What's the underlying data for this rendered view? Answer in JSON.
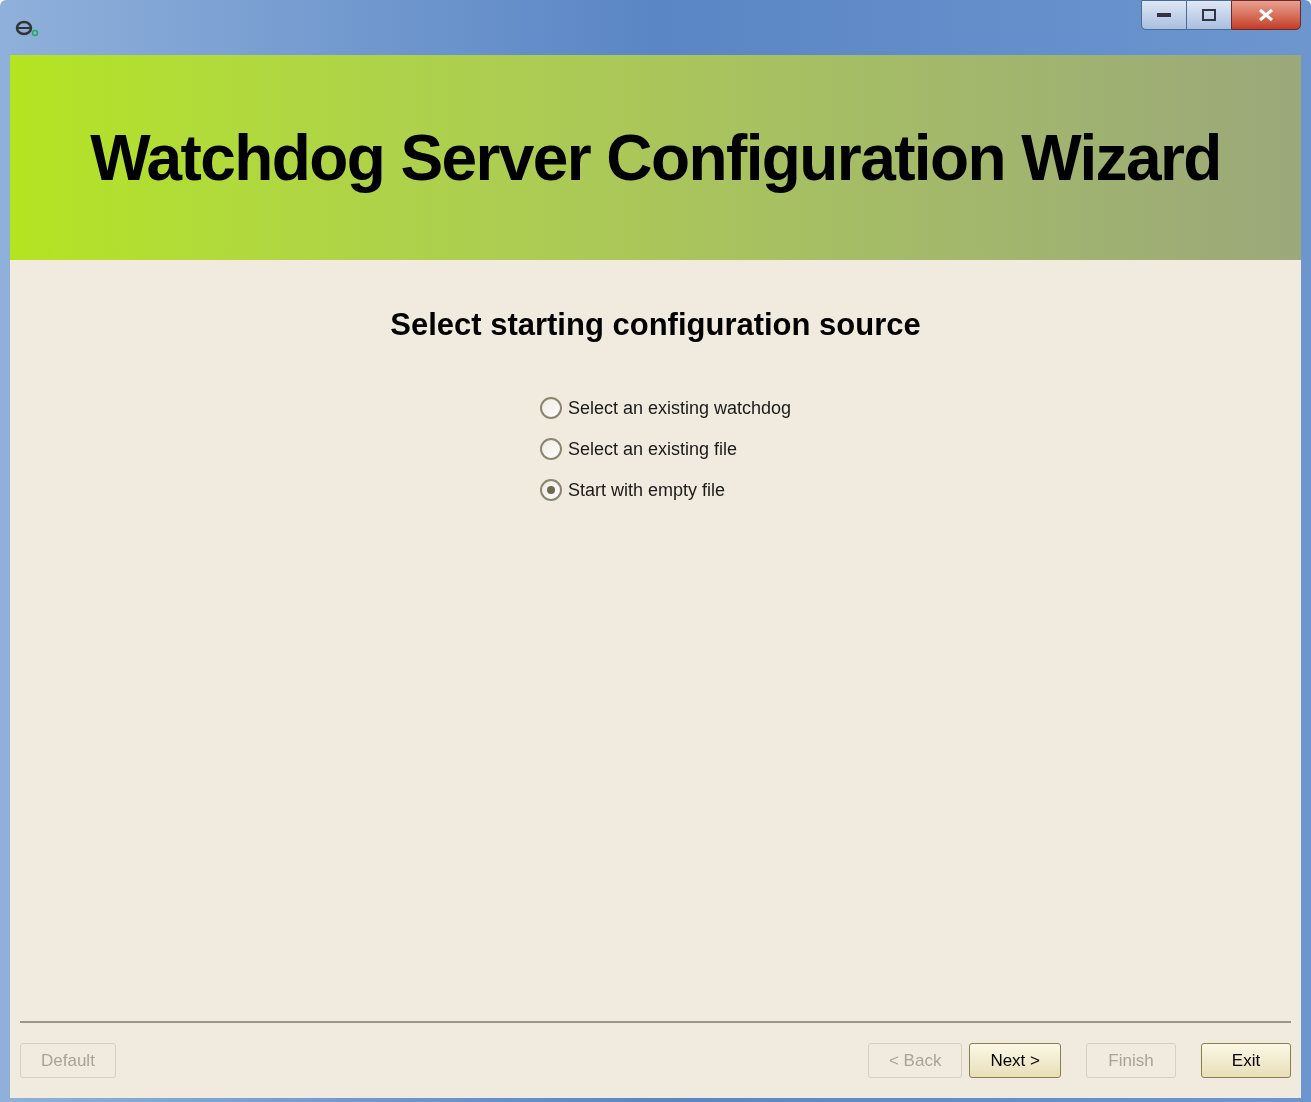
{
  "banner": {
    "title": "Watchdog Server Configuration Wizard"
  },
  "heading": "Select starting configuration source",
  "options": [
    {
      "label": "Select an existing watchdog",
      "selected": false
    },
    {
      "label": "Select an existing file",
      "selected": false
    },
    {
      "label": "Start with empty file",
      "selected": true
    }
  ],
  "left_buttons": [
    {
      "label": "Default",
      "disabled": true
    }
  ],
  "right_buttons": [
    {
      "label": "< Back",
      "disabled": true
    },
    {
      "label": "Next >",
      "disabled": false
    },
    {
      "label": "Finish",
      "disabled": true
    },
    {
      "label": "Exit",
      "disabled": false
    }
  ]
}
